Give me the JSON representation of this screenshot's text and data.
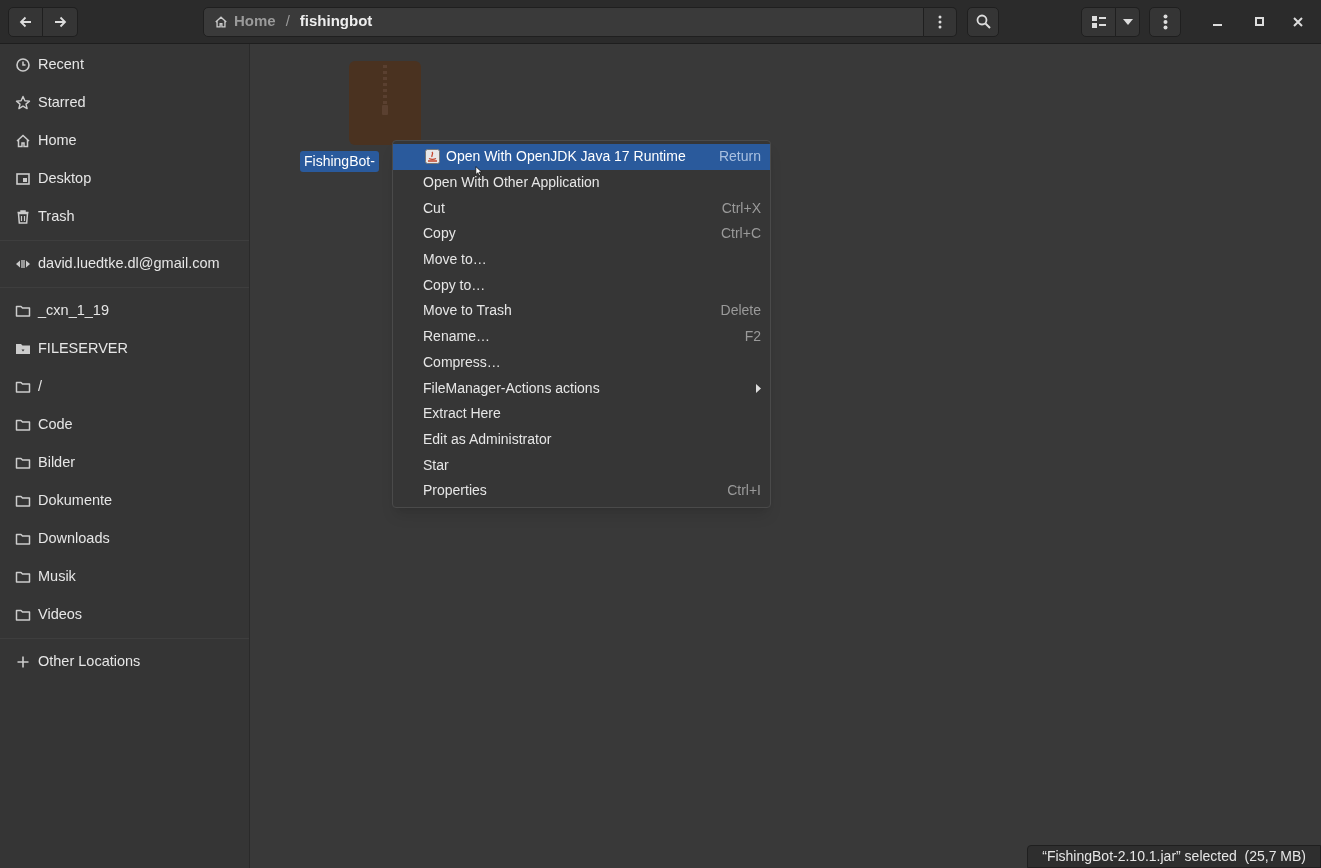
{
  "path_bar": {
    "crumbs": [
      {
        "label": "Home",
        "kind": "home",
        "selected": false
      },
      {
        "label": "fishingbot",
        "kind": "folder",
        "selected": true
      }
    ],
    "separator": "/"
  },
  "sidebar": {
    "groups": [
      [
        {
          "label": "Recent",
          "kind": "recent"
        },
        {
          "label": "Starred",
          "kind": "starred"
        },
        {
          "label": "Home",
          "kind": "home"
        },
        {
          "label": "Desktop",
          "kind": "desktop"
        },
        {
          "label": "Trash",
          "kind": "trash"
        }
      ],
      [
        {
          "label": "david.luedtke.dl@gmail.com",
          "kind": "remote"
        }
      ],
      [
        {
          "label": "_cxn_1_19",
          "kind": "folder"
        },
        {
          "label": "FILESERVER",
          "kind": "drive"
        },
        {
          "label": "/",
          "kind": "folder"
        },
        {
          "label": "Code",
          "kind": "folder"
        },
        {
          "label": "Bilder",
          "kind": "folder"
        },
        {
          "label": "Dokumente",
          "kind": "folder"
        },
        {
          "label": "Downloads",
          "kind": "folder"
        },
        {
          "label": "Musik",
          "kind": "folder"
        },
        {
          "label": "Videos",
          "kind": "folder"
        }
      ],
      [
        {
          "label": "Other Locations",
          "kind": "other"
        }
      ]
    ]
  },
  "files": [
    {
      "name": "FishingBot-",
      "selected": true
    }
  ],
  "context_menu": [
    {
      "label": "Open With OpenJDK Java 17 Runtime",
      "shortcut": "Return",
      "kind": "app",
      "selected": true
    },
    {
      "label": "Open With Other Application",
      "kind": "action",
      "selected": false
    },
    {
      "label": "Cut",
      "shortcut": "Ctrl+X",
      "kind": "action",
      "selected": false
    },
    {
      "label": "Copy",
      "shortcut": "Ctrl+C",
      "kind": "action",
      "selected": false
    },
    {
      "label": "Move to…",
      "kind": "action",
      "selected": false
    },
    {
      "label": "Copy to…",
      "kind": "action",
      "selected": false
    },
    {
      "label": "Move to Trash",
      "shortcut": "Delete",
      "kind": "action",
      "selected": false
    },
    {
      "label": "Rename…",
      "shortcut": "F2",
      "kind": "action",
      "selected": false
    },
    {
      "label": "Compress…",
      "kind": "action",
      "selected": false
    },
    {
      "label": "FileManager-Actions actions",
      "kind": "submenu",
      "selected": false
    },
    {
      "label": "Extract Here",
      "kind": "action",
      "selected": false
    },
    {
      "label": "Edit as Administrator",
      "kind": "action",
      "selected": false
    },
    {
      "label": "Star",
      "kind": "action",
      "selected": false
    },
    {
      "label": "Properties",
      "shortcut": "Ctrl+I",
      "kind": "action",
      "selected": false
    }
  ],
  "status_bar": "“FishingBot-2.10.1.jar” selected  (25,7 MB)"
}
